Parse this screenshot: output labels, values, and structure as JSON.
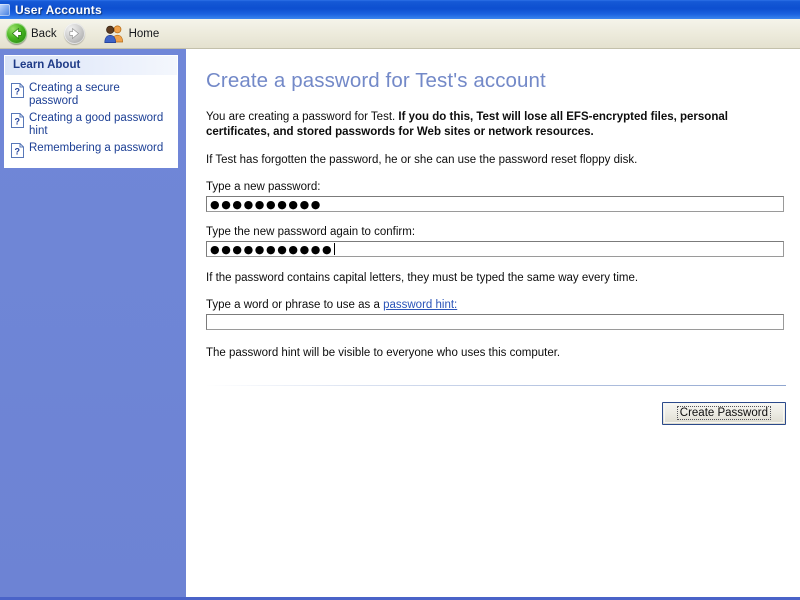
{
  "window": {
    "title": "User Accounts",
    "icon": "user-accounts-icon"
  },
  "toolbar": {
    "back_label": "Back",
    "back_icon": "back-arrow-icon",
    "forward_label": "",
    "forward_icon": "forward-arrow-icon",
    "home_label": "Home",
    "home_icon": "users-home-icon"
  },
  "sidebar": {
    "panel_title": "Learn About",
    "items": [
      {
        "label": "Creating a secure password",
        "icon": "help-question-icon"
      },
      {
        "label": "Creating a good password hint",
        "icon": "help-question-icon"
      },
      {
        "label": "Remembering a password",
        "icon": "help-question-icon"
      }
    ]
  },
  "main": {
    "heading": "Create a password for Test's account",
    "intro_plain": "You are creating a password for Test. ",
    "intro_bold": "If you do this, Test will lose all EFS-encrypted files, personal certificates, and stored passwords for Web sites or network resources.",
    "forgotten_note": "If Test has forgotten the password, he or she can use the password reset floppy disk.",
    "new_password_label": "Type a new password:",
    "new_password_value": "●●●●●●●●●●",
    "confirm_password_label": "Type the new password again to confirm:",
    "confirm_password_value": "●●●●●●●●●●●",
    "capital_letters_note": "If the password contains capital letters, they must be typed the same way every time.",
    "hint_label_prefix": "Type a word or phrase to use as a ",
    "hint_label_link": "password hint:",
    "hint_value": "",
    "hint_visibility_note": "The password hint will be visible to everyone who uses this computer.",
    "create_button_label": "Create Password"
  },
  "colors": {
    "titlebar_blue": "#0d4fd0",
    "sidebar_blue": "#6f86d6",
    "heading_blue": "#7389c8",
    "link_blue": "#1c3f94",
    "toolbar_beige": "#eceadb"
  }
}
